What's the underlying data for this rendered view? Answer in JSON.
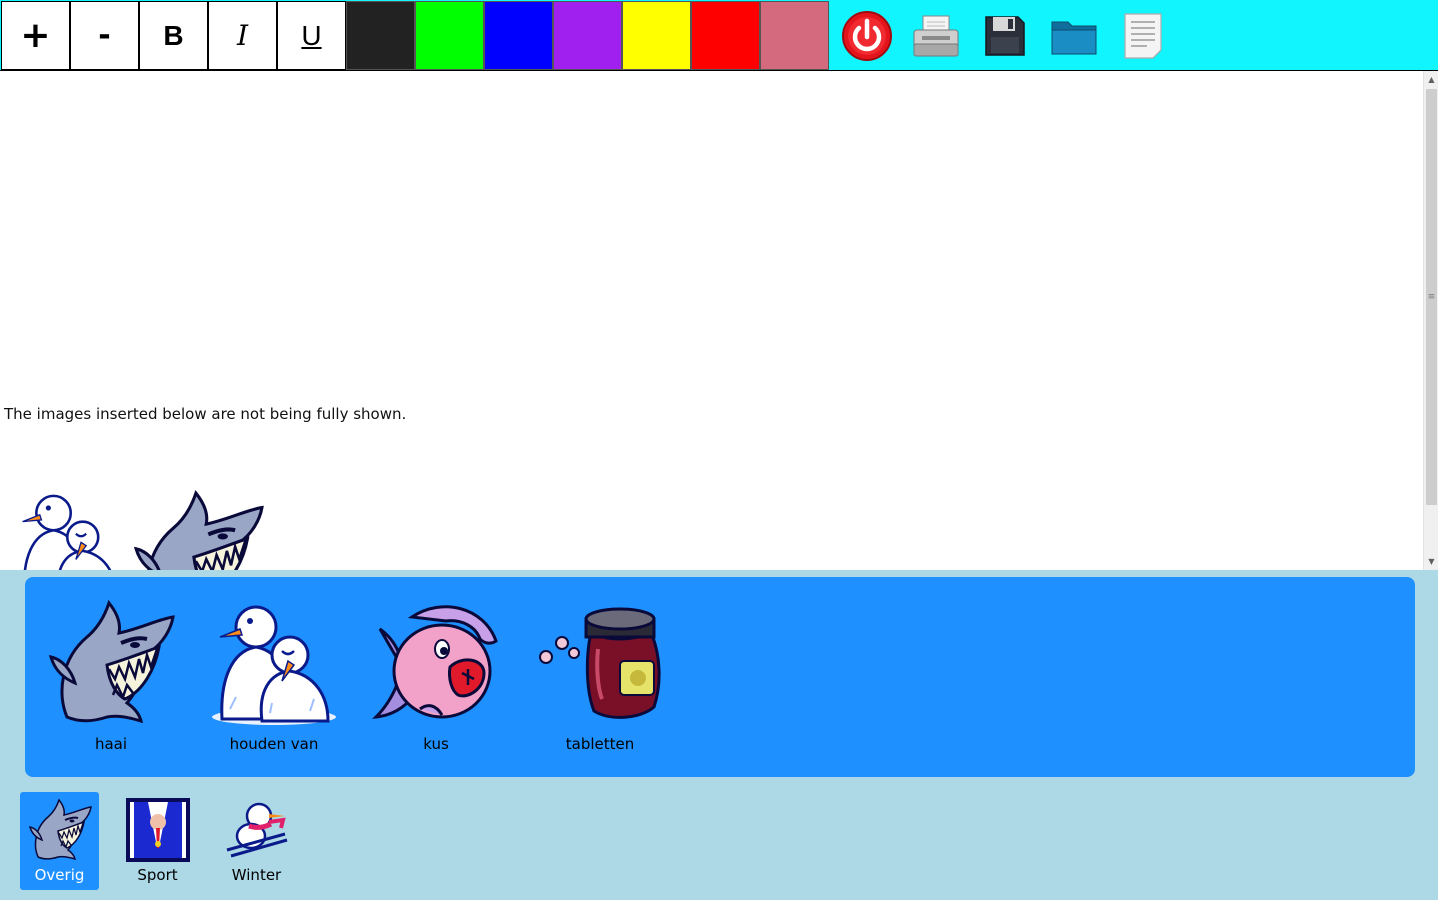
{
  "toolbar": {
    "format_buttons": [
      {
        "name": "increase-font-button",
        "label": "+"
      },
      {
        "name": "decrease-font-button",
        "label": "-"
      },
      {
        "name": "bold-button",
        "label": "B"
      },
      {
        "name": "italic-button",
        "label": "I"
      },
      {
        "name": "underline-button",
        "label": "U"
      }
    ],
    "colors": [
      {
        "name": "color-black",
        "hex": "#222222"
      },
      {
        "name": "color-green",
        "hex": "#00ff00"
      },
      {
        "name": "color-blue",
        "hex": "#0000ff"
      },
      {
        "name": "color-purple",
        "hex": "#a020f0"
      },
      {
        "name": "color-yellow",
        "hex": "#ffff00"
      },
      {
        "name": "color-red",
        "hex": "#ff0000"
      },
      {
        "name": "color-rose",
        "hex": "#d46a7e"
      }
    ],
    "tools": [
      "power-icon",
      "printer-icon",
      "save-disk-icon",
      "folder-icon",
      "new-document-icon"
    ],
    "background": "#11f5ff"
  },
  "editor": {
    "text": "The images inserted below are not being fully shown.",
    "inserted_images": [
      "snowmen-icon",
      "shark-icon"
    ]
  },
  "pictograms": [
    {
      "label": "haai",
      "icon": "shark-icon"
    },
    {
      "label": "houden van",
      "icon": "snowmen-icon"
    },
    {
      "label": "kus",
      "icon": "kissing-fish-icon"
    },
    {
      "label": "tabletten",
      "icon": "pill-jar-icon"
    }
  ],
  "categories": [
    {
      "label": "Overig",
      "icon": "shark-icon",
      "active": true
    },
    {
      "label": "Sport",
      "icon": "medal-icon",
      "active": false
    },
    {
      "label": "Winter",
      "icon": "ski-snowman-icon",
      "active": false
    }
  ],
  "colors": {
    "panel": "#1e90ff",
    "lower_background": "#add8e6"
  }
}
